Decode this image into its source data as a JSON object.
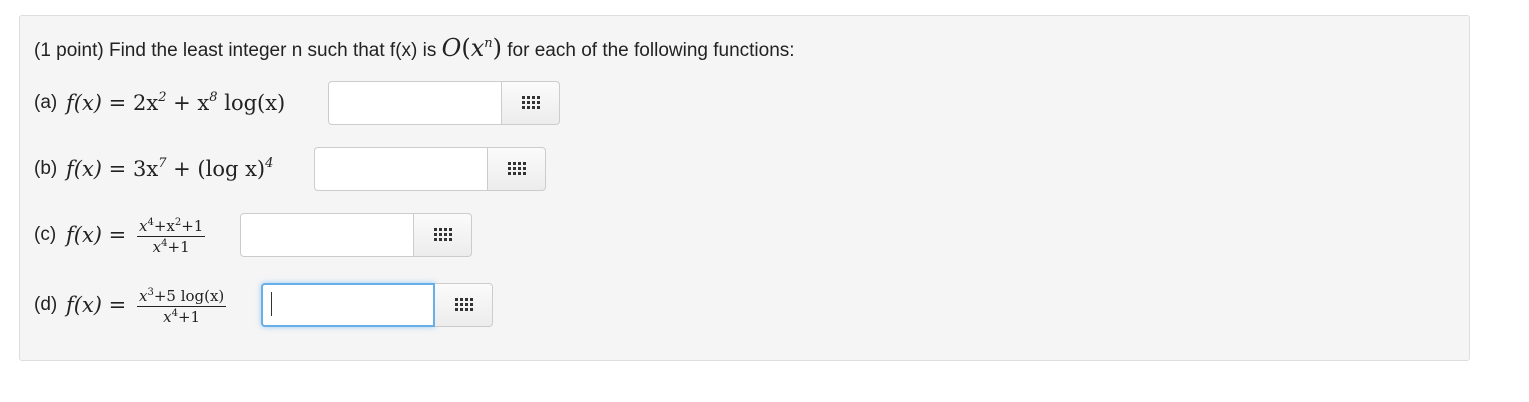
{
  "prompt": {
    "lead": "(1 point) Find the least integer n such that f(x) is",
    "big_o": "O",
    "open": "(",
    "var": "x",
    "exp": "n",
    "close": ")",
    "trail": "for each of the following functions:"
  },
  "parts": [
    {
      "label": "(a)",
      "lhs": "f(x) =",
      "t1": "2x",
      "e1": "2",
      "t2": " + x",
      "e2": "8",
      "t3": " log(x)",
      "input_value": ""
    },
    {
      "label": "(b)",
      "lhs": "f(x) =",
      "t1": "3x",
      "e1": "7",
      "t2": " + (log x)",
      "e2": "4",
      "input_value": ""
    },
    {
      "label": "(c)",
      "lhs": "f(x) =",
      "num_a": "x",
      "num_ae": "4",
      "num_b": "+x",
      "num_be": "2",
      "num_c": "+1",
      "den_a": "x",
      "den_ae": "4",
      "den_b": "+1",
      "input_value": ""
    },
    {
      "label": "(d)",
      "lhs": "f(x) =",
      "num_a": "x",
      "num_ae": "3",
      "num_b": "+5 log(x)",
      "den_a": "x",
      "den_ae": "4",
      "den_b": "+1",
      "input_value": ""
    }
  ],
  "icons": {
    "palette": "grid-icon"
  },
  "colors": {
    "focus": "#66afe9",
    "panel": "#f5f5f5"
  }
}
